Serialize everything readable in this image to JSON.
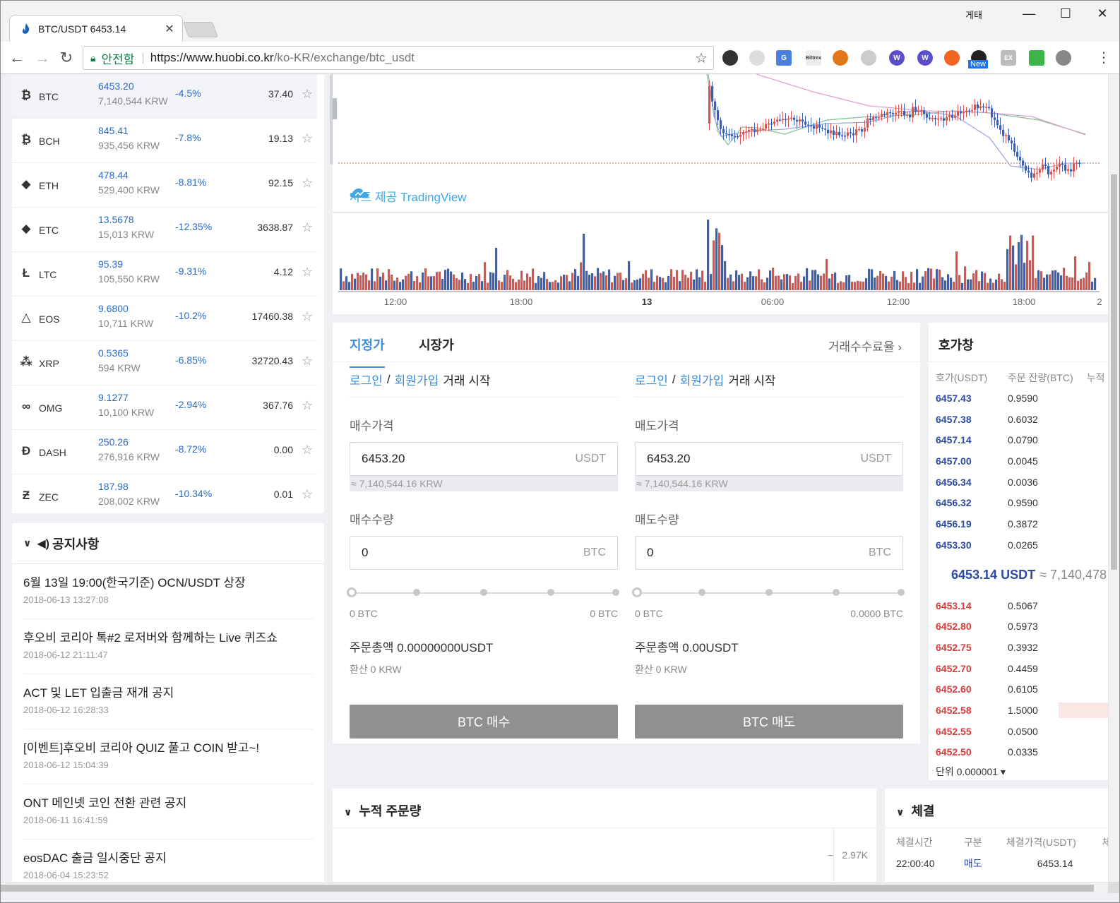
{
  "browser": {
    "tab_title": "BTC/USDT 6453.14",
    "window_user": "게태",
    "secure_label": "안전함",
    "url_host": "https://www.huobi.co.kr",
    "url_path": "/ko-KR/exchange/btc_usdt",
    "ext_new_badge": "New"
  },
  "markets": [
    {
      "symbol": "BTC",
      "icon": "bitcoin-icon",
      "glyph": "₿",
      "price": "6453.20",
      "krw": "7,140,544 KRW",
      "change": "-4.5%",
      "volume": "37.40",
      "selected": true
    },
    {
      "symbol": "BCH",
      "icon": "bitcoin-cash-icon",
      "glyph": "₿",
      "price": "845.41",
      "krw": "935,456 KRW",
      "change": "-7.8%",
      "volume": "19.13"
    },
    {
      "symbol": "ETH",
      "icon": "ethereum-icon",
      "glyph": "◆",
      "price": "478.44",
      "krw": "529,400 KRW",
      "change": "-8.81%",
      "volume": "92.15"
    },
    {
      "symbol": "ETC",
      "icon": "ethereum-classic-icon",
      "glyph": "◆",
      "price": "13.5678",
      "krw": "15,013 KRW",
      "change": "-12.35%",
      "volume": "3638.87"
    },
    {
      "symbol": "LTC",
      "icon": "litecoin-icon",
      "glyph": "Ł",
      "price": "95.39",
      "krw": "105,550 KRW",
      "change": "-9.31%",
      "volume": "4.12"
    },
    {
      "symbol": "EOS",
      "icon": "eos-icon",
      "glyph": "△",
      "price": "9.6800",
      "krw": "10,711 KRW",
      "change": "-10.2%",
      "volume": "17460.38"
    },
    {
      "symbol": "XRP",
      "icon": "ripple-icon",
      "glyph": "⁂",
      "price": "0.5365",
      "krw": "594 KRW",
      "change": "-6.85%",
      "volume": "32720.43"
    },
    {
      "symbol": "OMG",
      "icon": "omisego-icon",
      "glyph": "∞",
      "price": "9.1277",
      "krw": "10,100 KRW",
      "change": "-2.94%",
      "volume": "367.76"
    },
    {
      "symbol": "DASH",
      "icon": "dash-icon",
      "glyph": "Đ",
      "price": "250.26",
      "krw": "276,916 KRW",
      "change": "-8.72%",
      "volume": "0.00"
    },
    {
      "symbol": "ZEC",
      "icon": "zcash-icon",
      "glyph": "Ƶ",
      "price": "187.98",
      "krw": "208,002 KRW",
      "change": "-10.34%",
      "volume": "0.01"
    }
  ],
  "notice": {
    "title": "공지사항",
    "items": [
      {
        "title": "6월 13일 19:00(한국기준) OCN/USDT 상장",
        "date": "2018-06-13 13:27:08"
      },
      {
        "title": "후오비 코리아 톡#2 로저버와 함께하는 Live 퀴즈쇼",
        "date": "2018-06-12 21:11:47"
      },
      {
        "title": "ACT 및 LET 입출금 재개 공지",
        "date": "2018-06-12 16:28:33"
      },
      {
        "title": "[이벤트]후오비 코리아 QUIZ 풀고 COIN 받고~!",
        "date": "2018-06-12 15:04:39"
      },
      {
        "title": "ONT 메인넷 코인 전환 관련 공지",
        "date": "2018-06-11 16:41:59"
      },
      {
        "title": "eosDAC 출금 일시중단 공지",
        "date": "2018-06-04 15:23:52"
      }
    ]
  },
  "chart": {
    "watermark": "차트 제공 TradingView",
    "time_labels": [
      "12:00",
      "18:00",
      "13",
      "06:00",
      "12:00",
      "18:00",
      "2"
    ]
  },
  "order": {
    "tab_limit": "지정가",
    "tab_market": "시장가",
    "fee_link": "거래수수료율",
    "login": "로그인",
    "slash": "/",
    "signup": "회원가입",
    "start": "거래 시작",
    "buy": {
      "price_label": "매수가격",
      "price": "6453.20",
      "price_unit": "USDT",
      "approx": "≈ 7,140,544.16 KRW",
      "qty_label": "매수수량",
      "qty": "0",
      "qty_unit": "BTC",
      "slider_min": "0 BTC",
      "slider_max": "0 BTC",
      "total": "주문총액 0.00000000USDT",
      "conv": "환산   0   KRW",
      "button": "BTC 매수"
    },
    "sell": {
      "price_label": "매도가격",
      "price": "6453.20",
      "price_unit": "USDT",
      "approx": "≈ 7,140,544.16 KRW",
      "qty_label": "매도수량",
      "qty": "0",
      "qty_unit": "BTC",
      "slider_min": "0 BTC",
      "slider_max": "0.0000 BTC",
      "total": "주문총액 0.00USDT",
      "conv": "환산   0   KRW",
      "button": "BTC 매도"
    }
  },
  "orderbook": {
    "title": "호가창",
    "col_price": "호가(USDT)",
    "col_amount": "주문 잔량(BTC)",
    "col_cum": "누적",
    "asks": [
      {
        "p": "6457.43",
        "a": "0.9590"
      },
      {
        "p": "6457.38",
        "a": "0.6032"
      },
      {
        "p": "6457.14",
        "a": "0.0790"
      },
      {
        "p": "6457.00",
        "a": "0.0045"
      },
      {
        "p": "6456.34",
        "a": "0.0036"
      },
      {
        "p": "6456.32",
        "a": "0.9590"
      },
      {
        "p": "6456.19",
        "a": "0.3872"
      },
      {
        "p": "6453.30",
        "a": "0.0265"
      }
    ],
    "last_price": "6453.14 USDT",
    "last_krw": "≈ 7,140,478",
    "bids": [
      {
        "p": "6453.14",
        "a": "0.5067"
      },
      {
        "p": "6452.80",
        "a": "0.5973"
      },
      {
        "p": "6452.75",
        "a": "0.3932"
      },
      {
        "p": "6452.70",
        "a": "0.4459"
      },
      {
        "p": "6452.60",
        "a": "0.6105"
      },
      {
        "p": "6452.58",
        "a": "1.5000",
        "bar": true
      },
      {
        "p": "6452.55",
        "a": "0.0500"
      },
      {
        "p": "6452.50",
        "a": "0.0335"
      }
    ],
    "unit": "단위 0.000001 ▾",
    "colors": {
      "ask": "#2b4aa0",
      "bid": "#d93a3a"
    }
  },
  "depth": {
    "title": "누적 주문량",
    "axis_value": "2.97K"
  },
  "trades": {
    "title": "체결",
    "col_time": "체결시간",
    "col_side": "구분",
    "col_price": "체결가격(USDT)",
    "col_more": "체",
    "rows": [
      {
        "time": "22:00:40",
        "side": "매도",
        "price": "6453.14"
      }
    ]
  }
}
